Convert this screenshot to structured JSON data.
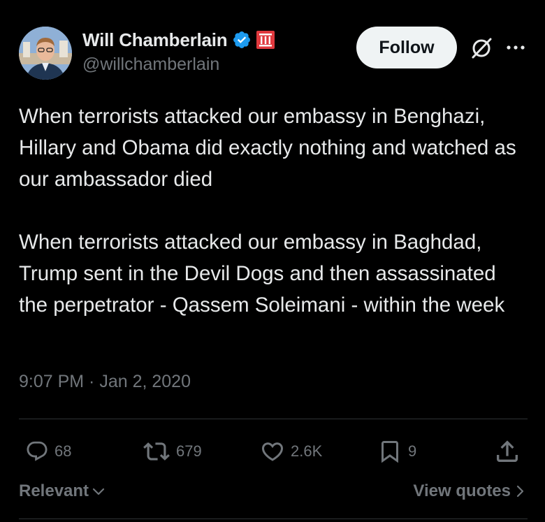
{
  "author": {
    "display_name": "Will Chamberlain",
    "handle": "@willchamberlain",
    "verified": true,
    "avatar_icon": "profile-photo",
    "affiliation_icon": "columns-badge-icon"
  },
  "follow_label": "Follow",
  "tweet": {
    "paragraphs": [
      "When terrorists attacked our embassy in Benghazi, Hillary and Obama did exactly nothing and watched as our ambassador died",
      "When terrorists attacked our embassy in Baghdad, Trump sent in the Devil Dogs and then assassinated the perpetrator - Qassem Soleimani - within the week"
    ],
    "timestamp": "9:07 PM · Jan 2, 2020"
  },
  "actions": {
    "replies": "68",
    "reposts": "679",
    "likes": "2.6K",
    "bookmarks": "9"
  },
  "footer": {
    "sort_label": "Relevant",
    "view_quotes_label": "View quotes"
  },
  "colors": {
    "background": "#000000",
    "primary_text": "#e7e9ea",
    "secondary_text": "#71767b",
    "verified_blue": "#1d9bf0",
    "badge_red": "#e0393e",
    "divider": "#2f3336"
  }
}
